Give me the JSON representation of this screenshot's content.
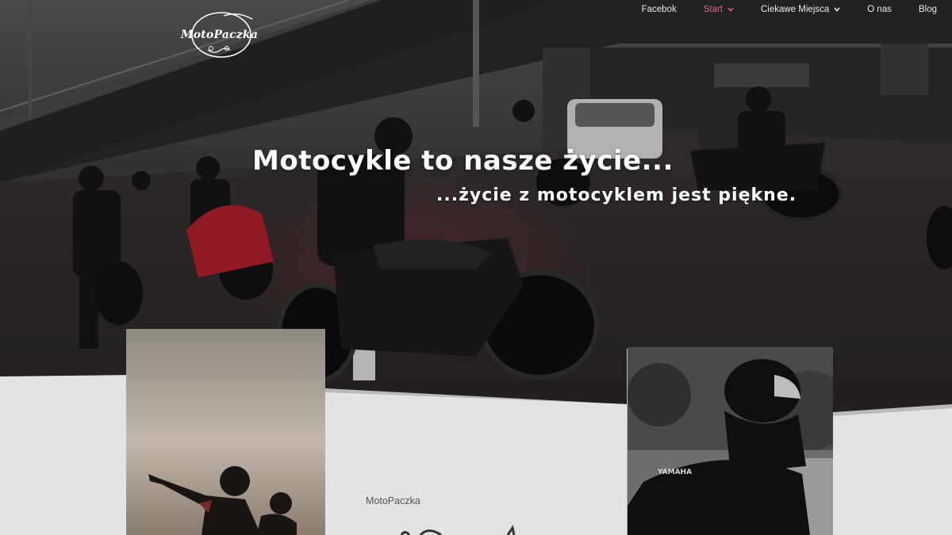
{
  "site": {
    "logo_text": "MotoPaczka"
  },
  "nav": {
    "items": [
      {
        "label": "Facebok",
        "has_dropdown": false,
        "active": false
      },
      {
        "label": "Start",
        "has_dropdown": true,
        "active": true
      },
      {
        "label": "Ciekawe Miejsca",
        "has_dropdown": true,
        "active": false
      },
      {
        "label": "O nas",
        "has_dropdown": false,
        "active": false
      },
      {
        "label": "Blog",
        "has_dropdown": false,
        "active": false
      }
    ]
  },
  "hero": {
    "headline": "Motocykle to nasze życie...",
    "subheadline": "...życie z motocyklem jest piękne."
  },
  "content": {
    "brand_label": "MotoPaczka"
  },
  "colors": {
    "accent": "#e0677f",
    "content_bg": "#e3e3e3",
    "nav_text": "#eaeaea"
  }
}
